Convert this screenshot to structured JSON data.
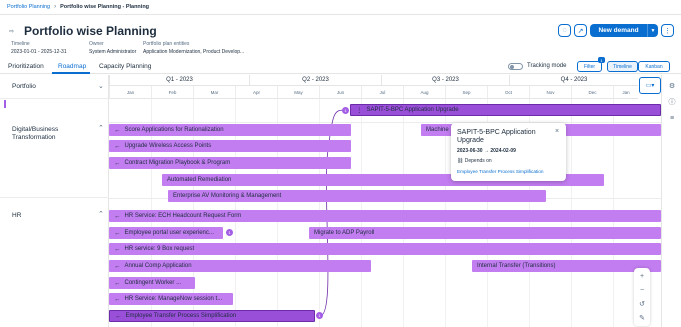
{
  "breadcrumb": {
    "items": [
      "Portfolio Planning",
      "Portfolio wise Planning - Planning"
    ]
  },
  "header": {
    "title": "Portfolio wise Planning",
    "timeline_label": "Timeline",
    "timeline_value": "2023-01-01 - 2025-12-31",
    "owner_label": "Owner",
    "owner_value": "System Administrator",
    "entities_label": "Portfolio plan entities",
    "entities_value": "Application Modernization, Product Develop...",
    "new_demand": "New demand"
  },
  "tabs": [
    "Prioritization",
    "Roadmap",
    "Capacity Planning"
  ],
  "toolbar": {
    "tracking_mode": "Tracking mode",
    "filter": "Filter",
    "filter_count": "1",
    "timeline": "Timeline",
    "kanban": "Kanban"
  },
  "timeline": {
    "quarters": [
      "Q1 - 2023",
      "Q2 - 2023",
      "Q3 - 2023",
      "Q4 - 2023"
    ],
    "months": [
      "Jan",
      "Feb",
      "Mar",
      "Apr",
      "May",
      "Jun",
      "Jul",
      "Aug",
      "Sep",
      "Oct",
      "Nov",
      "Dec",
      "Jan"
    ]
  },
  "groups": [
    "Portfolio",
    "Digital/Business Transformation",
    "HR"
  ],
  "bars": {
    "sapit": "SAPIT-5-BPC Application Upgrade",
    "score": "Score Applications for Rationalization",
    "machine": "Machine",
    "upgrade_wap": "Upgrade Wireless Access Points",
    "contract": "Contract Migration Playbook & Program",
    "automated": "Automated Remediation",
    "enterprise": "Enterprise AV Monitoring & Management",
    "hr_ech": "HR Service: ECH Headcount Request Form",
    "portal": "Employee portal user experienc...",
    "adp": "Migrate to ADP Payroll",
    "box": "HR service: 9 Box request",
    "annual": "Annual Comp Application",
    "transfer": "Internal Transfer (Transitions)",
    "contingent": "Contingent Worker ...",
    "managenow": "HR Service: ManageNow session t...",
    "employee_transfer": "Employee Transfer Process Simplification"
  },
  "badges": {
    "sapit": "1",
    "portal": "1",
    "employee_transfer": "1"
  },
  "popover": {
    "title": "SAPIT-5-BPC Application Upgrade",
    "dates": "2023-06-30 → 2024-02-09",
    "depends_on_label": "Depends on",
    "link": "Employee Transfer Process Simplification"
  },
  "colors": {
    "accent": "#0a6ed1",
    "bar": "#c27df0",
    "bar_selected": "#9a4fd9"
  }
}
